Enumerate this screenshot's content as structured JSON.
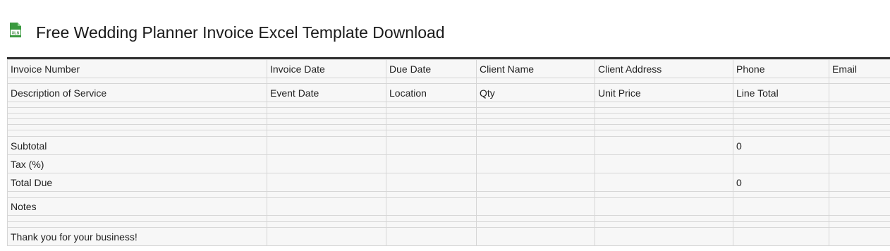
{
  "page": {
    "title": "Free Wedding Planner Invoice Excel Template Download",
    "icon": "excel-file-icon",
    "icon_label": "XLS",
    "accent_color": "#3a9a3f"
  },
  "sheet": {
    "header_row": [
      "Invoice Number",
      "Invoice Date",
      "Due Date",
      "Client Name",
      "Client Address",
      "Phone",
      "Email"
    ],
    "service_header_row": [
      "Description of Service",
      "Event Date",
      "Location",
      "Qty",
      "Unit Price",
      "Line Total",
      ""
    ],
    "subtotal_label": "Subtotal",
    "subtotal_value": "0",
    "tax_label": "Tax (%)",
    "total_due_label": "Total Due",
    "total_due_value": "0",
    "notes_label": "Notes",
    "footer_text": "Thank you for your business!"
  }
}
